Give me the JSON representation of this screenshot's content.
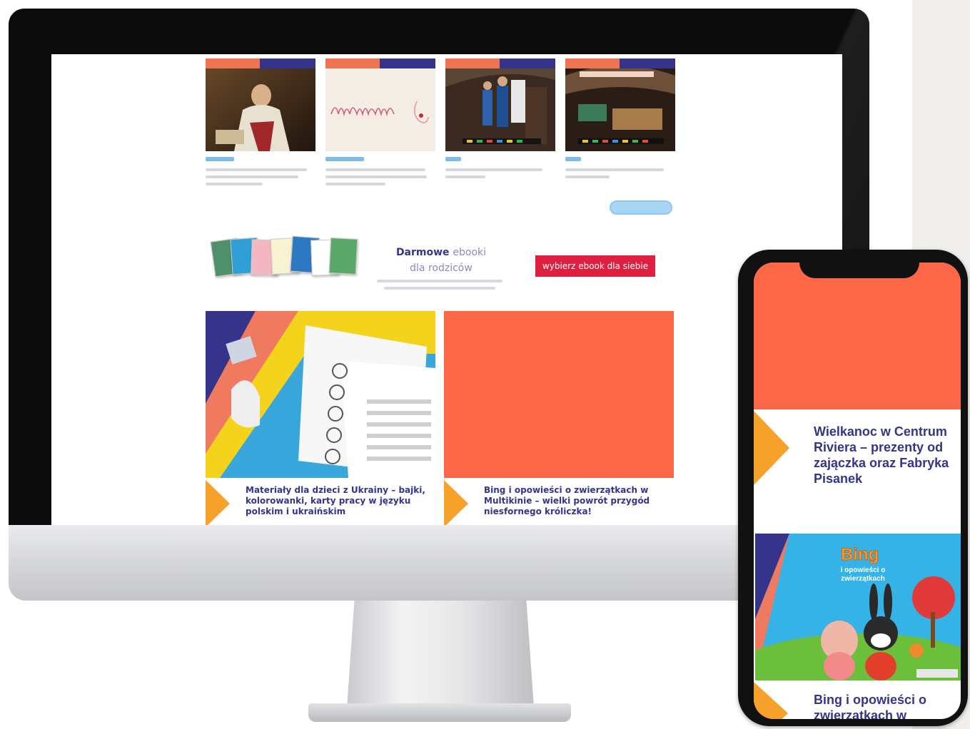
{
  "desktop": {
    "cards": [
      {
        "image": "portrait-painting"
      },
      {
        "image": "handwriting-sketch"
      },
      {
        "image": "museum-visitors"
      },
      {
        "image": "dark-interior-exhibit"
      }
    ],
    "ebook": {
      "title_bold": "Darmowe",
      "title_light": "ebooki",
      "subtitle": "dla rodziców",
      "button_label": "wybierz ebook dla siebie"
    },
    "tiles": [
      {
        "title": "Materiały dla dzieci z Ukrainy – bajki, kolorowanki, karty pracy w języku polskim i ukraińskim",
        "image": "worksheets-photo"
      },
      {
        "title": "Bing i opowieści o zwierzątkach w Multikinie – wielki powrót przygód niesfornego króliczka!",
        "image": "orange-placeholder"
      }
    ]
  },
  "mobile": {
    "hero_color": "#fe6745",
    "title_1": "Wielkanoc w Centrum Riviera – prezenty od zajączka oraz Fabryka Pisanek",
    "poster_title": "Bing",
    "poster_subtitle": "i opowieści o zwierzątkach",
    "title_2": "Bing i opowieści o zwierzątkach w"
  },
  "colors": {
    "navy": "#34358a",
    "coral": "#fe6745",
    "orange_arrow": "#f5a12a",
    "ebook_red": "#df1f3d",
    "link_blue": "#7fbbe5"
  }
}
